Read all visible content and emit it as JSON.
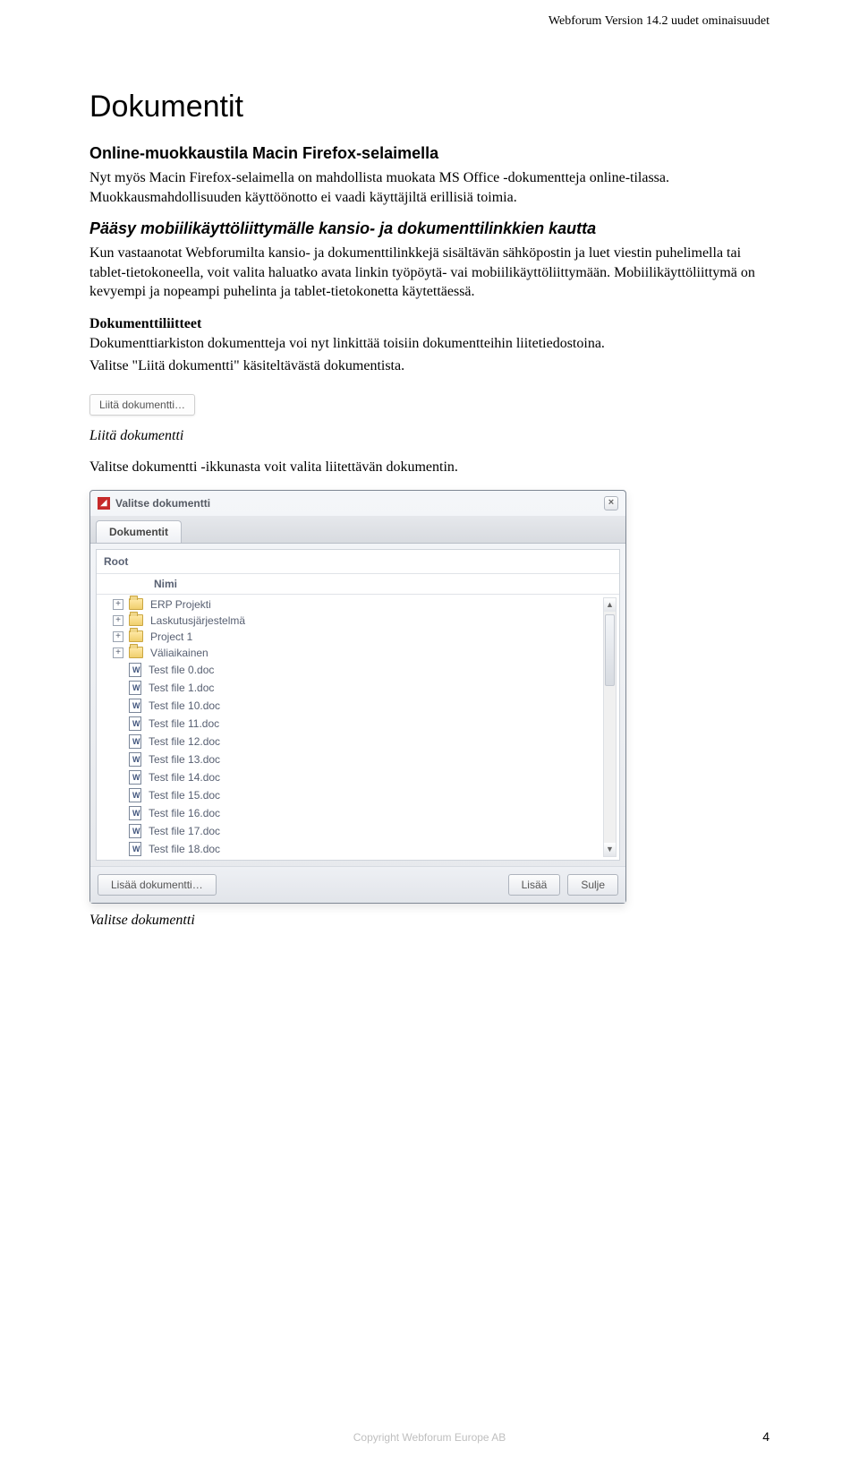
{
  "header": {
    "right": "Webforum  Version 14.2 uudet ominaisuudet"
  },
  "h1": "Dokumentit",
  "section1": {
    "heading": "Online-muokkaustila Macin Firefox-selaimella",
    "p1": "Nyt myös Macin Firefox-selaimella on mahdollista muokata MS Office -dokumentteja online-tilassa. Muokkausmahdollisuuden käyttöönotto ei vaadi käyttäjiltä erillisiä toimia."
  },
  "section2": {
    "heading": "Pääsy mobiilikäyttöliittymälle kansio- ja dokumenttilinkkien kautta",
    "p1": "Kun vastaanotat Webforumilta kansio- ja dokumenttilinkkejä sisältävän sähköpostin ja luet viestin puhelimella tai tablet-tietokoneella, voit valita haluatko avata linkin työpöytä- vai mobiilikäyttöliittymään. Mobiilikäyttöliittymä on kevyempi ja nopeampi puhelinta ja tablet-tietokonetta käytettäessä."
  },
  "section3": {
    "heading": "Dokumenttiliitteet",
    "p1": "Dokumenttiarkiston dokumentteja voi nyt linkittää toisiin dokumentteihin liitetiedostoina.",
    "p2": "Valitse \"Liitä dokumentti\" käsiteltävästä dokumentista."
  },
  "attachButtonLabel": "Liitä dokumentti…",
  "caption1": "Liitä dokumentti",
  "p3": "Valitse dokumentti -ikkunasta voit valita liitettävän dokumentin.",
  "dialog": {
    "title": "Valitse dokumentti",
    "tab": "Dokumentit",
    "root": "Root",
    "colName": "Nimi",
    "rows": [
      {
        "type": "folder",
        "expandable": true,
        "label": "ERP Projekti"
      },
      {
        "type": "folder",
        "expandable": true,
        "label": "Laskutusjärjestelmä"
      },
      {
        "type": "folder",
        "expandable": true,
        "label": "Project 1"
      },
      {
        "type": "folder",
        "expandable": true,
        "label": "Väliaikainen"
      },
      {
        "type": "doc",
        "expandable": false,
        "label": "Test file 0.doc"
      },
      {
        "type": "doc",
        "expandable": false,
        "label": "Test file 1.doc"
      },
      {
        "type": "doc",
        "expandable": false,
        "label": "Test file 10.doc"
      },
      {
        "type": "doc",
        "expandable": false,
        "label": "Test file 11.doc"
      },
      {
        "type": "doc",
        "expandable": false,
        "label": "Test file 12.doc"
      },
      {
        "type": "doc",
        "expandable": false,
        "label": "Test file 13.doc"
      },
      {
        "type": "doc",
        "expandable": false,
        "label": "Test file 14.doc"
      },
      {
        "type": "doc",
        "expandable": false,
        "label": "Test file 15.doc"
      },
      {
        "type": "doc",
        "expandable": false,
        "label": "Test file 16.doc"
      },
      {
        "type": "doc",
        "expandable": false,
        "label": "Test file 17.doc"
      },
      {
        "type": "doc",
        "expandable": false,
        "label": "Test file 18.doc"
      }
    ],
    "buttons": {
      "addDoc": "Lisää dokumentti…",
      "add": "Lisää",
      "close": "Sulje"
    }
  },
  "caption2": "Valitse dokumentti",
  "footer": "Copyright   Webforum Europe AB",
  "pageNumber": "4"
}
